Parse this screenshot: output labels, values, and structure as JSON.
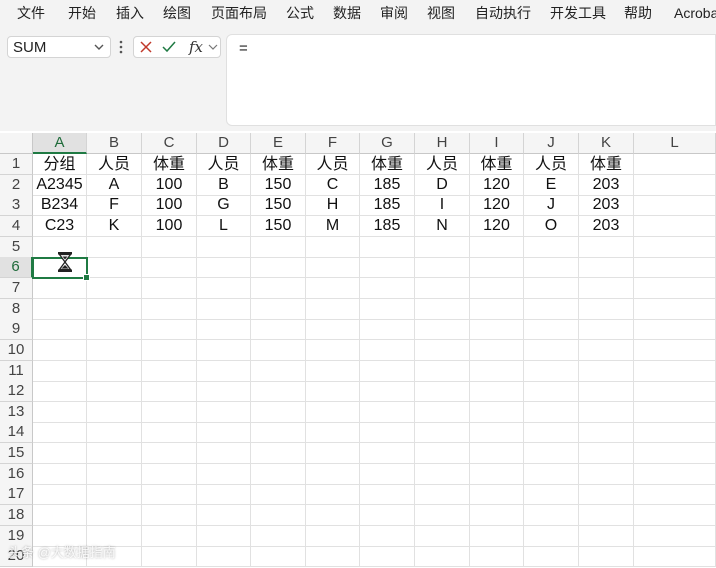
{
  "menubar": {
    "items": [
      "文件",
      "开始",
      "插入",
      "绘图",
      "页面布局",
      "公式",
      "数据",
      "审阅",
      "视图",
      "自动执行",
      "开发工具",
      "帮助",
      "Acroba"
    ]
  },
  "formula_bar": {
    "name_box": "SUM",
    "formula": "=",
    "fx_label": "fx"
  },
  "grid": {
    "columns": [
      "A",
      "B",
      "C",
      "D",
      "E",
      "F",
      "G",
      "H",
      "I",
      "J",
      "K",
      "L"
    ],
    "row_numbers": [
      "1",
      "2",
      "3",
      "4",
      "5",
      "6",
      "7",
      "8",
      "9",
      "10",
      "11",
      "12",
      "13",
      "14",
      "15",
      "16",
      "17",
      "18",
      "19",
      "20"
    ],
    "rows": [
      [
        "分组",
        "人员",
        "体重",
        "人员",
        "体重",
        "人员",
        "体重",
        "人员",
        "体重",
        "人员",
        "体重",
        ""
      ],
      [
        "A2345",
        "A",
        "100",
        "B",
        "150",
        "C",
        "185",
        "D",
        "120",
        "E",
        "203",
        ""
      ],
      [
        "B234",
        "F",
        "100",
        "G",
        "150",
        "H",
        "185",
        "I",
        "120",
        "J",
        "203",
        ""
      ],
      [
        "C23",
        "K",
        "100",
        "L",
        "150",
        "M",
        "185",
        "N",
        "120",
        "O",
        "203",
        ""
      ]
    ],
    "selected_column": "A",
    "selected_row": "6",
    "selected_color": "#1f7a43"
  },
  "icons": {
    "cancel": "x-icon",
    "enter": "check-icon",
    "busy": "hourglass-icon"
  },
  "watermark": "头条 @大数据指南"
}
